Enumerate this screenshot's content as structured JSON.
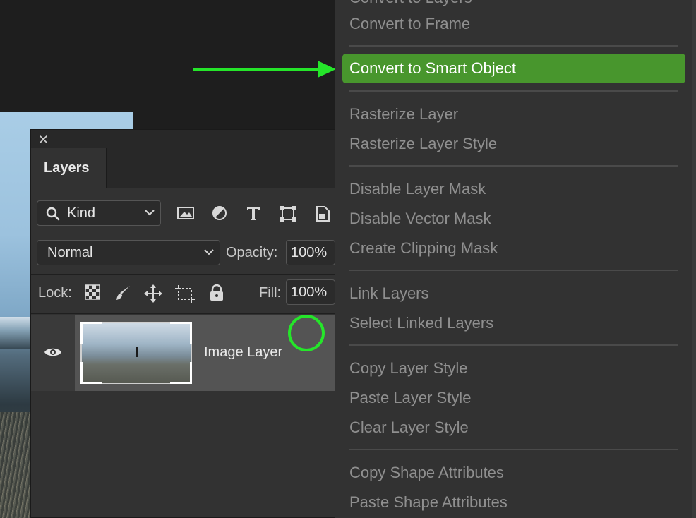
{
  "panel": {
    "close_label": "✕",
    "tab_label": "Layers",
    "filter": {
      "kind_label": "Kind"
    },
    "blend": {
      "mode": "Normal",
      "opacity_label": "Opacity:",
      "opacity_value": "100%"
    },
    "lock": {
      "lock_label": "Lock:",
      "fill_label": "Fill:",
      "fill_value": "100%"
    },
    "layer": {
      "name": "Image Layer"
    }
  },
  "menu": {
    "partial_top": "Convert to Layers",
    "items": [
      "Convert to Frame",
      "Convert to Smart Object",
      "Rasterize Layer",
      "Rasterize Layer Style",
      "Disable Layer Mask",
      "Disable Vector Mask",
      "Create Clipping Mask",
      "Link Layers",
      "Select Linked Layers",
      "Copy Layer Style",
      "Paste Layer Style",
      "Clear Layer Style",
      "Copy Shape Attributes",
      "Paste Shape Attributes"
    ],
    "highlighted": "Convert to Smart Object"
  },
  "colors": {
    "highlight": "#48962d",
    "annotation": "#25e52a"
  }
}
